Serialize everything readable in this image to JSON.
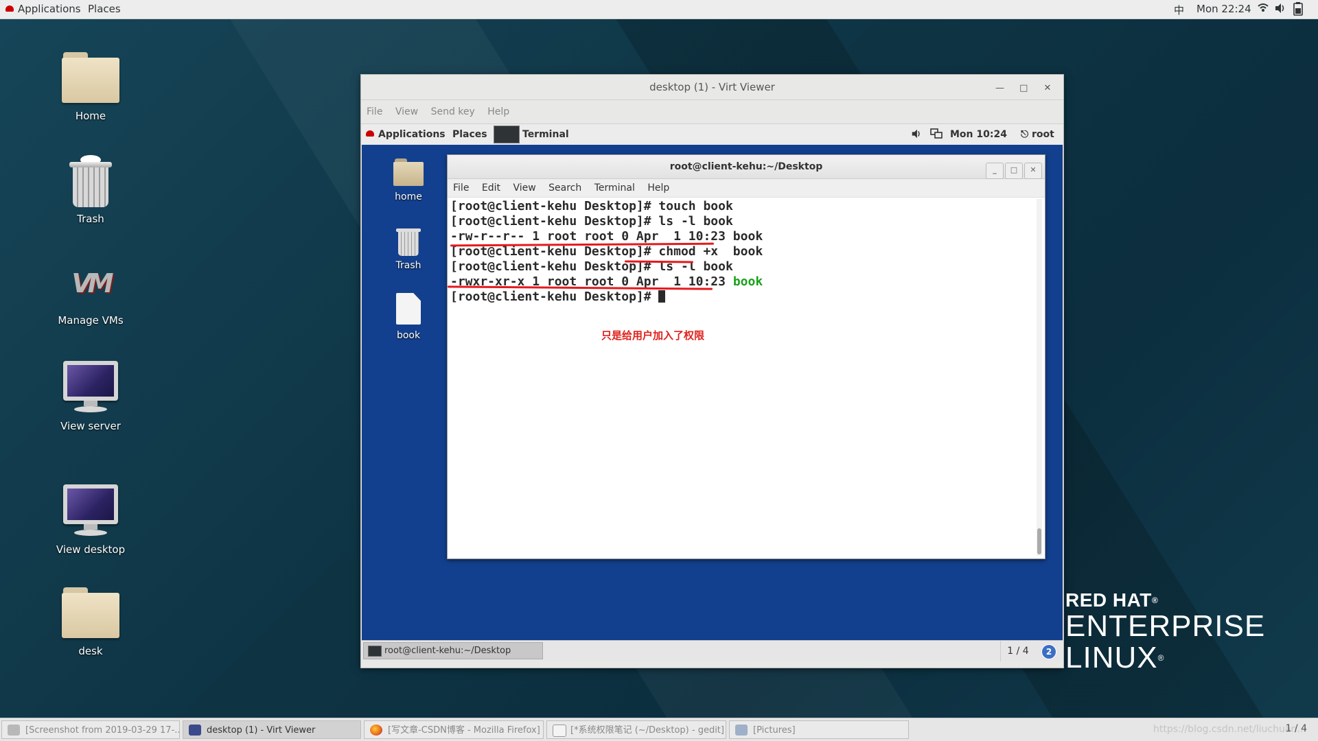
{
  "host_topbar": {
    "applications": "Applications",
    "places": "Places",
    "input_method": "中",
    "clock": "Mon 22:24"
  },
  "desktop_icons": [
    {
      "label": "Home"
    },
    {
      "label": "Trash"
    },
    {
      "label": "Manage VMs"
    },
    {
      "label": "View server"
    },
    {
      "label": "View desktop"
    },
    {
      "label": "desk"
    }
  ],
  "virt_viewer": {
    "title": "desktop (1) - Virt Viewer",
    "menu": [
      "File",
      "View",
      "Send key",
      "Help"
    ]
  },
  "guest": {
    "topbar": {
      "applications": "Applications",
      "places": "Places",
      "terminal": "Terminal",
      "clock": "Mon 10:24",
      "user": "root"
    },
    "icons": [
      {
        "label": "home"
      },
      {
        "label": "Trash"
      },
      {
        "label": "book"
      }
    ],
    "terminal": {
      "title": "root@client-kehu:~/Desktop",
      "menu": [
        "File",
        "Edit",
        "View",
        "Search",
        "Terminal",
        "Help"
      ],
      "lines": [
        "[root@client-kehu Desktop]# touch book",
        "[root@client-kehu Desktop]# ls -l book",
        "-rw-r--r-- 1 root root 0 Apr  1 10:23 book",
        "[root@client-kehu Desktop]# chmod +x  book",
        "[root@client-kehu Desktop]# ls -l book",
        "-rwxr-xr-x 1 root root 0 Apr  1 10:23 ",
        "[root@client-kehu Desktop]# "
      ],
      "green_filename": "book",
      "annotation": "只是给用户加入了权限",
      "annotation_color": "#e0201c"
    },
    "bottom_task": "root@client-kehu:~/Desktop",
    "workspace": "1 / 4",
    "notification_count": "2"
  },
  "brand": {
    "line1": "RED HAT",
    "line2": "ENTERPRISE",
    "line3": "LINUX",
    "reg": "®"
  },
  "taskbar": {
    "items": [
      "[Screenshot from 2019-03-29 17-...",
      "desktop (1) - Virt Viewer",
      "[写文章-CSDN博客 - Mozilla Firefox]",
      "[*系统权限笔记 (~/Desktop) - gedit]",
      "[Pictures]"
    ],
    "watermark": "https://blog.csdn.net/liuchuan...",
    "page": "1 / 4"
  }
}
